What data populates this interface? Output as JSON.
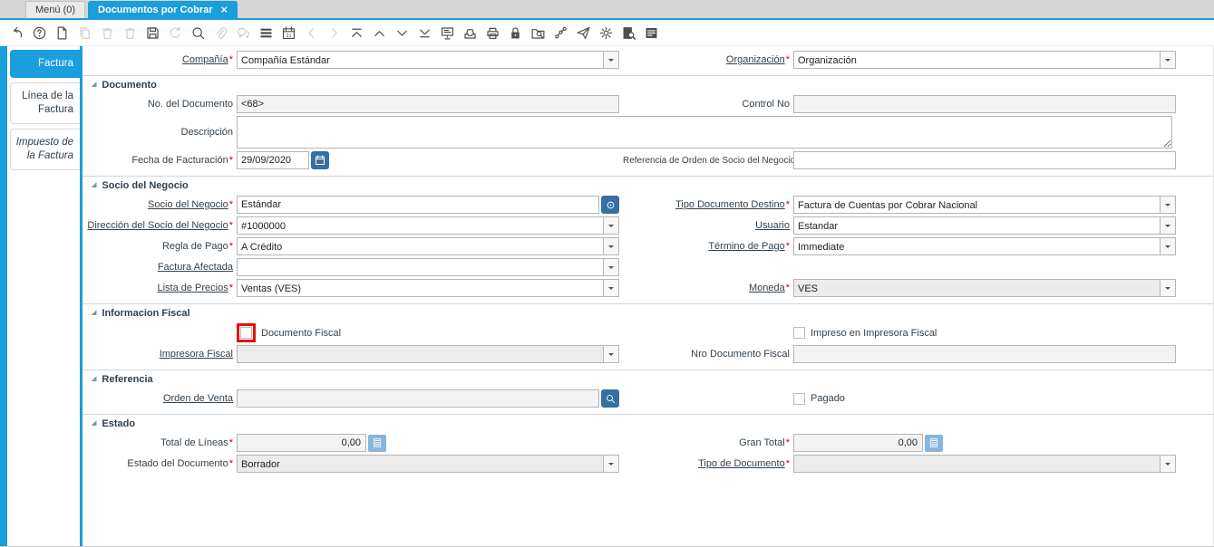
{
  "colors": {
    "accent": "#1a9edc",
    "button_blue": "#35709e",
    "calculator_blue": "#88b6da",
    "required_red": "#d40000",
    "highlight_red": "#e80d0d"
  },
  "glyphs": {
    "close": "×",
    "section_arrow": "◢"
  },
  "window_tabs": [
    {
      "label": "Menú (0)",
      "active": false,
      "closable": false
    },
    {
      "label": "Documentos por Cobrar",
      "active": true,
      "closable": true
    }
  ],
  "toolbar": {
    "icons": [
      {
        "name": "undo-icon",
        "enabled": true
      },
      {
        "name": "help-icon",
        "enabled": true
      },
      {
        "name": "new-record-icon",
        "enabled": true
      },
      {
        "name": "copy-record-icon",
        "enabled": false
      },
      {
        "name": "delete-record-icon",
        "enabled": false
      },
      {
        "name": "delete-selection-icon",
        "enabled": false
      },
      {
        "name": "save-icon",
        "enabled": true
      },
      {
        "name": "refresh-icon",
        "enabled": false
      },
      {
        "name": "find-icon",
        "enabled": true
      },
      {
        "name": "attachment-icon",
        "enabled": false
      },
      {
        "name": "chat-icon",
        "enabled": false
      },
      {
        "name": "grid-toggle-icon",
        "enabled": true
      },
      {
        "name": "calendar-icon",
        "enabled": true
      },
      {
        "name": "previous-icon",
        "enabled": false
      },
      {
        "name": "next-icon",
        "enabled": false
      },
      {
        "name": "first-record-icon",
        "enabled": true
      },
      {
        "name": "previous-record-icon",
        "enabled": true
      },
      {
        "name": "next-record-icon",
        "enabled": true
      },
      {
        "name": "last-record-icon",
        "enabled": true
      },
      {
        "name": "report-icon",
        "enabled": true
      },
      {
        "name": "archive-icon",
        "enabled": true
      },
      {
        "name": "print-icon",
        "enabled": true
      },
      {
        "name": "lock-icon",
        "enabled": true
      },
      {
        "name": "export-icon",
        "enabled": true
      },
      {
        "name": "workflow-icon",
        "enabled": true
      },
      {
        "name": "send-icon",
        "enabled": true
      },
      {
        "name": "preferences-icon",
        "enabled": true
      },
      {
        "name": "zoom-across-icon",
        "enabled": true
      },
      {
        "name": "report-view-icon",
        "enabled": true
      }
    ]
  },
  "sidebar": {
    "tabs": [
      {
        "label": "Factura",
        "active": true,
        "italic": false
      },
      {
        "label": "Línea de la Factura",
        "active": false,
        "italic": false
      },
      {
        "label": "Impuesto de la Factura",
        "active": false,
        "italic": true
      }
    ]
  },
  "form": {
    "sections": [
      {
        "title": null,
        "rows": [
          [
            {
              "col": "a",
              "label": "Compañía",
              "required": true,
              "link": true,
              "type": "select",
              "value": "Compañía Estándar"
            },
            {
              "col": "b",
              "label": "Organización",
              "required": true,
              "link": true,
              "type": "select",
              "value": "Organización"
            }
          ]
        ]
      },
      {
        "title": "Documento",
        "rows": [
          [
            {
              "col": "a",
              "label": "No. del Documento",
              "type": "text",
              "value": "<68>",
              "readonly": true
            },
            {
              "col": "b",
              "label": "Control No",
              "type": "text",
              "value": "",
              "readonly": true
            }
          ],
          [
            {
              "col": "full",
              "label": "Descripción",
              "type": "textarea",
              "value": ""
            }
          ],
          [
            {
              "col": "a",
              "label": "Fecha de Facturación",
              "required": true,
              "type": "date",
              "value": "29/09/2020",
              "button": "calendar"
            },
            {
              "col": "b",
              "label": "Referencia de Orden de Socio del Negocio",
              "small": true,
              "type": "text",
              "value": ""
            }
          ]
        ]
      },
      {
        "title": "Socio del Negocio",
        "rows": [
          [
            {
              "col": "a",
              "label": "Socio del Negocio",
              "required": true,
              "link": true,
              "type": "text-button",
              "value": "Estándar",
              "button": "record"
            },
            {
              "col": "b",
              "label": "Tipo Documento Destino",
              "required": true,
              "link": true,
              "type": "select",
              "value": "Factura de Cuentas por Cobrar Nacional"
            }
          ],
          [
            {
              "col": "a",
              "label": "Dirección del Socio del Negocio",
              "required": true,
              "link": true,
              "type": "select",
              "value": "#1000000"
            },
            {
              "col": "b",
              "label": "Usuario",
              "link": true,
              "type": "select",
              "value": "Estandar"
            }
          ],
          [
            {
              "col": "a",
              "label": "Regla de Pago",
              "required": true,
              "type": "select",
              "value": "A Crédito"
            },
            {
              "col": "b",
              "label": "Término de Pago",
              "required": true,
              "link": true,
              "type": "select",
              "value": "Immediate"
            }
          ],
          [
            {
              "col": "a",
              "label": "Factura Afectada",
              "link": true,
              "type": "select",
              "value": ""
            }
          ],
          [
            {
              "col": "a",
              "label": "Lista de Precios",
              "required": true,
              "link": true,
              "type": "select",
              "value": "Ventas (VES)"
            },
            {
              "col": "b",
              "label": "Moneda",
              "required": true,
              "link": true,
              "type": "select",
              "value": "VES",
              "readonly": true
            }
          ]
        ]
      },
      {
        "title": "Informacion Fiscal",
        "rows": [
          [
            {
              "col": "a",
              "label": "Documento Fiscal",
              "type": "checkbox",
              "checked": false,
              "highlight": true
            },
            {
              "col": "b",
              "label": "Impreso en Impresora Fiscal",
              "type": "checkbox",
              "checked": false
            }
          ],
          [
            {
              "col": "a",
              "label": "Impresora Fiscal",
              "link": true,
              "type": "select",
              "value": "",
              "readonly": true
            },
            {
              "col": "b",
              "label": "Nro Documento Fiscal",
              "type": "text",
              "value": "",
              "readonly": true
            }
          ]
        ]
      },
      {
        "title": "Referencia",
        "rows": [
          [
            {
              "col": "a",
              "label": "Orden de Venta",
              "link": true,
              "type": "text-button",
              "value": "",
              "readonly": true,
              "button": "search"
            },
            {
              "col": "b",
              "label": "Pagado",
              "type": "checkbox",
              "checked": false
            }
          ]
        ]
      },
      {
        "title": "Estado",
        "rows": [
          [
            {
              "col": "a",
              "label": "Total de Líneas",
              "required": true,
              "type": "amount",
              "value": "0,00",
              "button": "calculator"
            },
            {
              "col": "b",
              "label": "Gran Total",
              "required": true,
              "type": "amount",
              "value": "0,00",
              "button": "calculator"
            }
          ],
          [
            {
              "col": "a",
              "label": "Estado del Documento",
              "required": true,
              "type": "select",
              "value": "Borrador",
              "readonly": true
            },
            {
              "col": "b",
              "label": "Tipo de Documento",
              "required": true,
              "link": true,
              "type": "select",
              "value": "",
              "readonly": true
            }
          ]
        ]
      }
    ]
  }
}
